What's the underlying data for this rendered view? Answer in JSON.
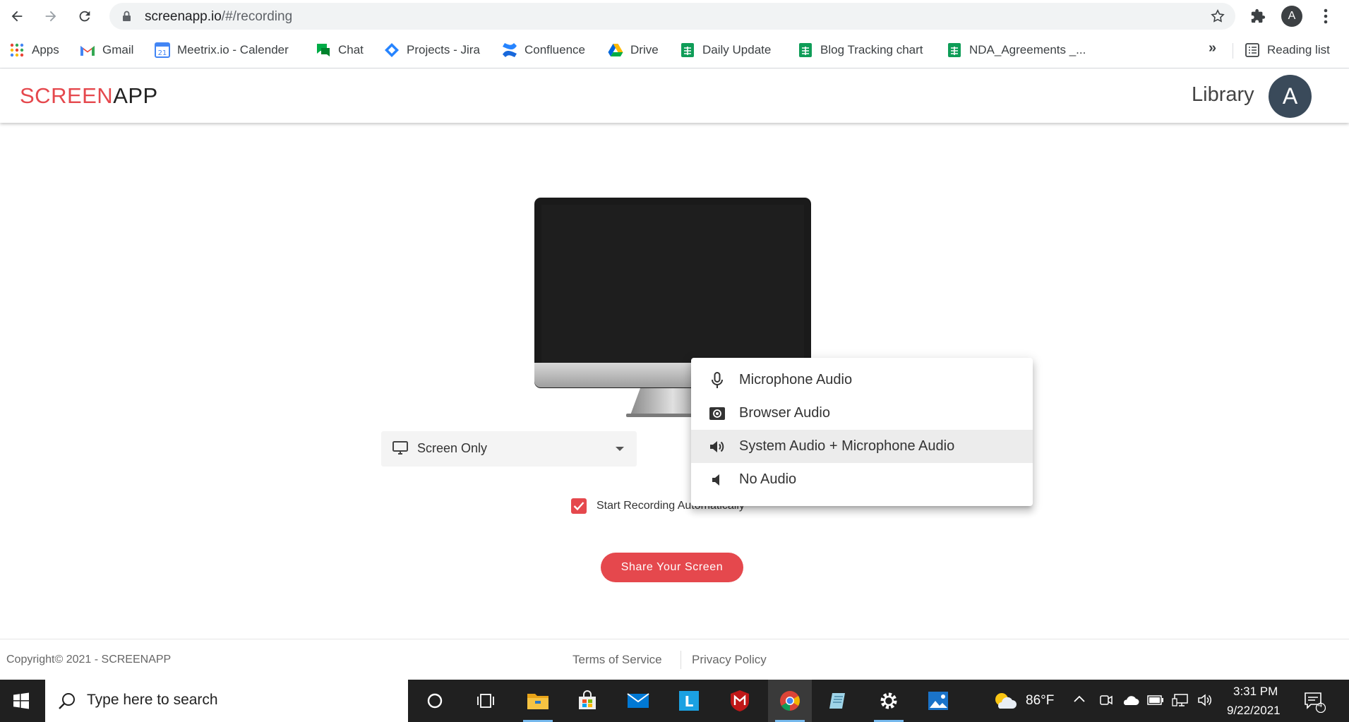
{
  "browser": {
    "url_host": "screenapp.io",
    "url_path": "/#/recording",
    "profile_initial": "A",
    "reading_list_label": "Reading list",
    "more_bookmarks": "»",
    "bookmarks": [
      {
        "label": "Apps",
        "icon": "apps-grid-icon"
      },
      {
        "label": "Gmail",
        "icon": "gmail-icon"
      },
      {
        "label": "Meetrix.io - Calender",
        "icon": "calendar-icon"
      },
      {
        "label": "Chat",
        "icon": "chat-icon"
      },
      {
        "label": "Projects - Jira",
        "icon": "jira-icon"
      },
      {
        "label": "Confluence",
        "icon": "confluence-icon"
      },
      {
        "label": "Drive",
        "icon": "drive-icon"
      },
      {
        "label": "Daily Update",
        "icon": "sheets-icon"
      },
      {
        "label": "Blog Tracking chart",
        "icon": "sheets-icon"
      },
      {
        "label": "NDA_Agreements _...",
        "icon": "sheets-icon"
      }
    ]
  },
  "app": {
    "logo_part1": "SCREEN",
    "logo_part2": "APP",
    "library_label": "Library",
    "avatar_initial": "A",
    "brand_color": "#e5484d"
  },
  "recorder": {
    "source_value": "Screen Only",
    "auto_start_label": "Start Recording Automatically",
    "auto_start_checked": true,
    "share_button": "Share Your Screen"
  },
  "audio_menu": {
    "items": [
      {
        "label": "Microphone Audio",
        "icon": "microphone-icon"
      },
      {
        "label": "Browser Audio",
        "icon": "browser-audio-icon"
      },
      {
        "label": "System Audio + Microphone Audio",
        "icon": "speaker-icon",
        "highlighted": true
      },
      {
        "label": "No Audio",
        "icon": "speaker-muted-icon"
      }
    ]
  },
  "footer": {
    "copyright": "Copyright©   2021 - SCREENAPP",
    "terms": "Terms of Service",
    "privacy": "Privacy Policy"
  },
  "taskbar": {
    "search_placeholder": "Type here to search",
    "temperature": "86°F",
    "time": "3:31 PM",
    "date": "9/22/2021",
    "notification_count": "4"
  }
}
